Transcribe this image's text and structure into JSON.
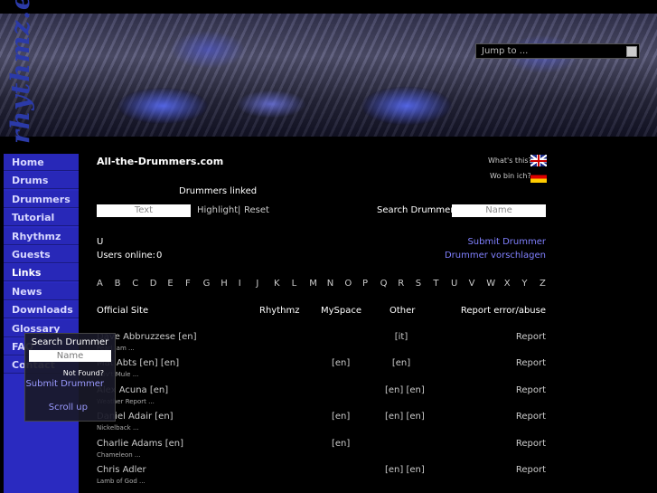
{
  "header": {
    "logo_text": "rhythmz.eu",
    "jump_label": "Jump to ..."
  },
  "sidebar": {
    "items": [
      "Home",
      "Drums",
      "Drummers",
      "Tutorial",
      "Rhythmz",
      "Guests",
      "Links",
      "News",
      "Downloads",
      "Glossary",
      "FAQ",
      "Contact"
    ],
    "active": "Links"
  },
  "popup": {
    "title": "Search Drummer",
    "placeholder": "Name",
    "not_found": "Not Found?",
    "submit": "Submit Drummer",
    "scroll_up": "Scroll up"
  },
  "main": {
    "site_title": "All-the-Drummers.com",
    "whats_this": "What's this?",
    "wo_bin_ich": "Wo bin ich?",
    "drummers_linked": "Drummers linked",
    "text_placeholder": "Text",
    "highlight": "Highlight",
    "separator": "|",
    "reset": "Reset",
    "search_label": "Search Drummer:",
    "search_placeholder": "Name",
    "current_letter": "U",
    "users_online_label": "Users online:",
    "users_online_count": "0",
    "submit_drummer": "Submit Drummer",
    "drummer_vorschlagen": "Drummer vorschlagen",
    "letters": [
      "A",
      "B",
      "C",
      "D",
      "E",
      "F",
      "G",
      "H",
      "I",
      "J",
      "K",
      "L",
      "M",
      "N",
      "O",
      "P",
      "Q",
      "R",
      "S",
      "T",
      "U",
      "V",
      "W",
      "X",
      "Y",
      "Z"
    ],
    "columns": [
      "Official Site",
      "Rhythmz",
      "MySpace",
      "Other",
      "Report error/abuse"
    ],
    "rows": [
      {
        "name": "Dave Abbruzzese [en]",
        "band": "Pearl Jam ...",
        "myspace": "",
        "other": "[it]",
        "report": "Report"
      },
      {
        "name": "Mat Abts [en] [en]",
        "band": "Gov't Mule ...",
        "myspace": "[en]",
        "other": "[en]",
        "report": "Report"
      },
      {
        "name": "Alex Acuna [en]",
        "band": "Weather Report ...",
        "myspace": "",
        "other": "[en] [en]",
        "report": "Report"
      },
      {
        "name": "Daniel Adair [en]",
        "band": "Nickelback ...",
        "myspace": "[en]",
        "other": "[en] [en]",
        "report": "Report"
      },
      {
        "name": "Charlie Adams [en]",
        "band": "Chameleon ...",
        "myspace": "[en]",
        "other": "",
        "report": "Report"
      },
      {
        "name": "Chris Adler",
        "band": "Lamb of God ...",
        "myspace": "",
        "other": "[en] [en]",
        "report": "Report"
      }
    ]
  }
}
